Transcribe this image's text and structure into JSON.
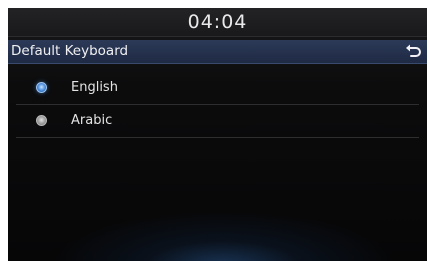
{
  "status": {
    "clock": "04:04"
  },
  "header": {
    "title": "Default Keyboard",
    "back_icon": "back-arrow-icon"
  },
  "options": [
    {
      "label": "English",
      "selected": true
    },
    {
      "label": "Arabic",
      "selected": false
    }
  ],
  "colors": {
    "title_bar": "#1f2a44",
    "selected_radio": "#2f72c6",
    "unselected_radio": "#a7a7a7",
    "text": "#e4e4e6"
  }
}
